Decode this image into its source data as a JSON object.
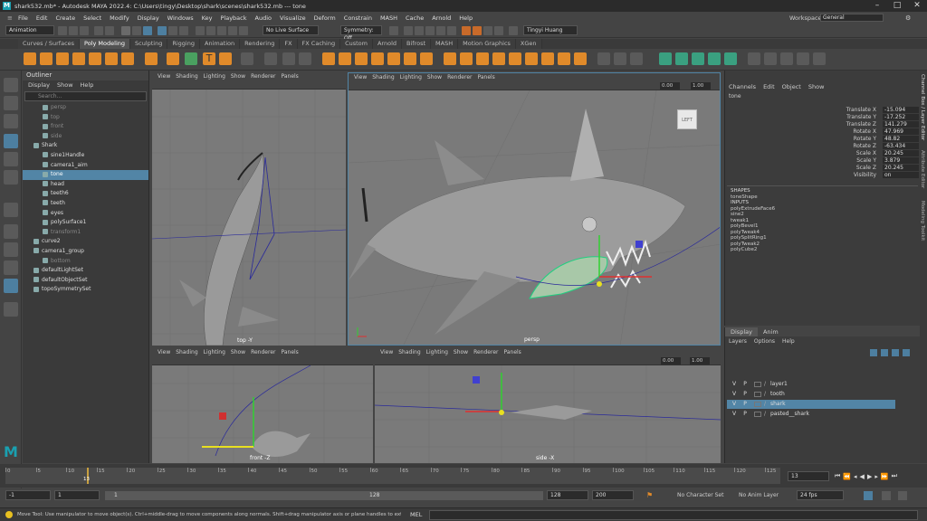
{
  "title_bar": {
    "text": "shark532.mb* - Autodesk MAYA 2022.4: C:\\Users\\tingy\\Desktop\\shark\\scenes\\shark532.mb  ---  tone"
  },
  "menu": [
    "File",
    "Edit",
    "Create",
    "Select",
    "Modify",
    "Display",
    "Windows",
    "Key",
    "Playback",
    "Audio",
    "Visualize",
    "Deform",
    "Constrain",
    "MASH",
    "Cache",
    "Arnold",
    "Help"
  ],
  "workspace": {
    "label": "Workspace:",
    "value": "General"
  },
  "status_line": {
    "mode": "Animation",
    "live_surface": "No Live Surface",
    "symmetry": "Symmetry: Off",
    "user": "Tingyi Huang"
  },
  "shelf_tabs": [
    "Curves / Surfaces",
    "Poly Modeling",
    "Sculpting",
    "Rigging",
    "Animation",
    "Rendering",
    "FX",
    "FX Caching",
    "Custom",
    "Arnold",
    "Bifrost",
    "MASH",
    "Motion Graphics",
    "XGen"
  ],
  "shelf_active": "Poly Modeling",
  "outliner": {
    "title": "Outliner",
    "menu": [
      "Display",
      "Show",
      "Help"
    ],
    "search_placeholder": "Search...",
    "items": [
      {
        "label": "persp",
        "dim": true,
        "indent": 1
      },
      {
        "label": "top",
        "dim": true,
        "indent": 1
      },
      {
        "label": "front",
        "dim": true,
        "indent": 1
      },
      {
        "label": "side",
        "dim": true,
        "indent": 1
      },
      {
        "label": "Shark",
        "dim": false,
        "indent": 0
      },
      {
        "label": "sine1Handle",
        "dim": false,
        "indent": 1
      },
      {
        "label": "camera1_aim",
        "dim": false,
        "indent": 1
      },
      {
        "label": "tone",
        "dim": false,
        "indent": 1,
        "selected": true
      },
      {
        "label": "head",
        "dim": false,
        "indent": 1
      },
      {
        "label": "teeth6",
        "dim": false,
        "indent": 1
      },
      {
        "label": "teeth",
        "dim": false,
        "indent": 1
      },
      {
        "label": "eyes",
        "dim": false,
        "indent": 1
      },
      {
        "label": "polySurface1",
        "dim": false,
        "indent": 1
      },
      {
        "label": "transform1",
        "dim": true,
        "indent": 1
      },
      {
        "label": "curve2",
        "dim": false,
        "indent": 0
      },
      {
        "label": "camera1_group",
        "dim": false,
        "indent": 0
      },
      {
        "label": "bottom",
        "dim": true,
        "indent": 1
      },
      {
        "label": "defaultLightSet",
        "dim": false,
        "indent": 0
      },
      {
        "label": "defaultObjectSet",
        "dim": false,
        "indent": 0
      },
      {
        "label": "topoSymmetrySet",
        "dim": false,
        "indent": 0
      }
    ]
  },
  "panel_menu": [
    "View",
    "Shading",
    "Lighting",
    "Show",
    "Renderer",
    "Panels"
  ],
  "viewports": {
    "top": {
      "label": "top -Y"
    },
    "persp": {
      "label": "persp",
      "cube": "LEFT",
      "val1": "0.00",
      "val2": "1.00"
    },
    "front": {
      "label": "front -Z"
    },
    "side": {
      "label": "side -X",
      "val1": "0.00",
      "val2": "1.00"
    }
  },
  "channel_box": {
    "menu": [
      "Channels",
      "Edit",
      "Object",
      "Show"
    ],
    "object": "tone",
    "attrs": [
      {
        "k": "Translate X",
        "v": "-15.094"
      },
      {
        "k": "Translate Y",
        "v": "-17.252"
      },
      {
        "k": "Translate Z",
        "v": "141.279"
      },
      {
        "k": "Rotate X",
        "v": "47.969"
      },
      {
        "k": "Rotate Y",
        "v": "48.82"
      },
      {
        "k": "Rotate Z",
        "v": "-63.434"
      },
      {
        "k": "Scale X",
        "v": "20.245"
      },
      {
        "k": "Scale Y",
        "v": "3.879"
      },
      {
        "k": "Scale Z",
        "v": "20.245"
      },
      {
        "k": "Visibility",
        "v": "on"
      }
    ],
    "shapes_header": "SHAPES",
    "shape": "toneShape",
    "inputs_header": "INPUTS",
    "inputs": [
      "polyExtrudeFace6",
      "sine2",
      "tweak1",
      "polyBevel1",
      "polyTweak4",
      "polySplitRing1",
      "polyTweak2",
      "polyCube2"
    ]
  },
  "layer_editor": {
    "tabs": [
      "Display",
      "Anim"
    ],
    "menu": [
      "Layers",
      "Options",
      "Help"
    ],
    "layers": [
      {
        "name": "layer1",
        "selected": false
      },
      {
        "name": "tooth",
        "selected": false
      },
      {
        "name": "shark",
        "selected": true
      },
      {
        "name": "pasted__shark",
        "selected": false
      }
    ],
    "v": "V",
    "p": "P"
  },
  "side_tabs": [
    "Channel Box / Layer Editor",
    "Attribute Editor",
    "Modeling Toolkit"
  ],
  "time_slider": {
    "ticks": [
      "0",
      "5",
      "10",
      "15",
      "20",
      "25",
      "30",
      "35",
      "40",
      "45",
      "50",
      "55",
      "60",
      "65",
      "70",
      "75",
      "80",
      "85",
      "90",
      "95",
      "100",
      "105",
      "110",
      "115",
      "120",
      "125"
    ],
    "current_marker": "13",
    "current_frame": "13"
  },
  "range": {
    "start": "-1",
    "start2": "1",
    "inner_start": "1",
    "inner_end": "128",
    "end": "128",
    "end2": "200",
    "character_set": "No Character Set",
    "anim_layer": "No Anim Layer",
    "fps": "24 fps"
  },
  "help_line": {
    "text": "Move Tool: Use manipulator to move object(s). Ctrl+middle-drag to move components along normals. Shift+drag manipulator axis or plane handles to extrude components or c",
    "mel": "MEL"
  }
}
